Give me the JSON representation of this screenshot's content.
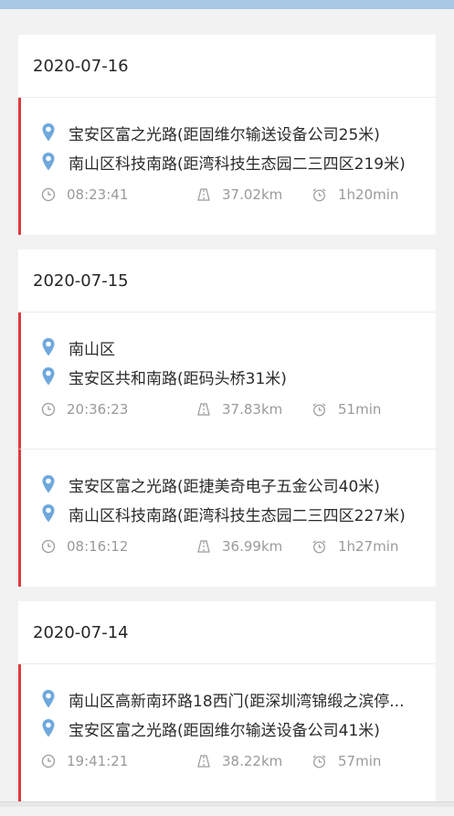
{
  "days": [
    {
      "date": "2020-07-16",
      "trips": [
        {
          "start": "宝安区富之光路(距固维尔输送设备公司25米)",
          "end": "南山区科技南路(距湾科技生态园二三四区219米)",
          "time": "08:23:41",
          "distance": "37.02km",
          "duration": "1h20min"
        }
      ]
    },
    {
      "date": "2020-07-15",
      "trips": [
        {
          "start": "南山区",
          "end": "宝安区共和南路(距码头桥31米)",
          "time": "20:36:23",
          "distance": "37.83km",
          "duration": "51min"
        },
        {
          "start": "宝安区富之光路(距捷美奇电子五金公司40米)",
          "end": "南山区科技南路(距湾科技生态园二三四区227米)",
          "time": "08:16:12",
          "distance": "36.99km",
          "duration": "1h27min"
        }
      ]
    },
    {
      "date": "2020-07-14",
      "trips": [
        {
          "start": "南山区高新南环路18西门(距深圳湾锦缎之滨停...",
          "end": "宝安区富之光路(距固维尔输送设备公司41米)",
          "time": "19:41:21",
          "distance": "38.22km",
          "duration": "57min"
        }
      ]
    }
  ],
  "icons": {
    "location": "location-pin-icon",
    "time": "clock-icon",
    "distance": "road-icon",
    "duration": "alarm-clock-icon"
  },
  "colors": {
    "accent_bar": "#e0393e",
    "pin": "#6fa8dc",
    "meta_text": "#9a9a9a",
    "top_bar": "#a9c8e4"
  }
}
